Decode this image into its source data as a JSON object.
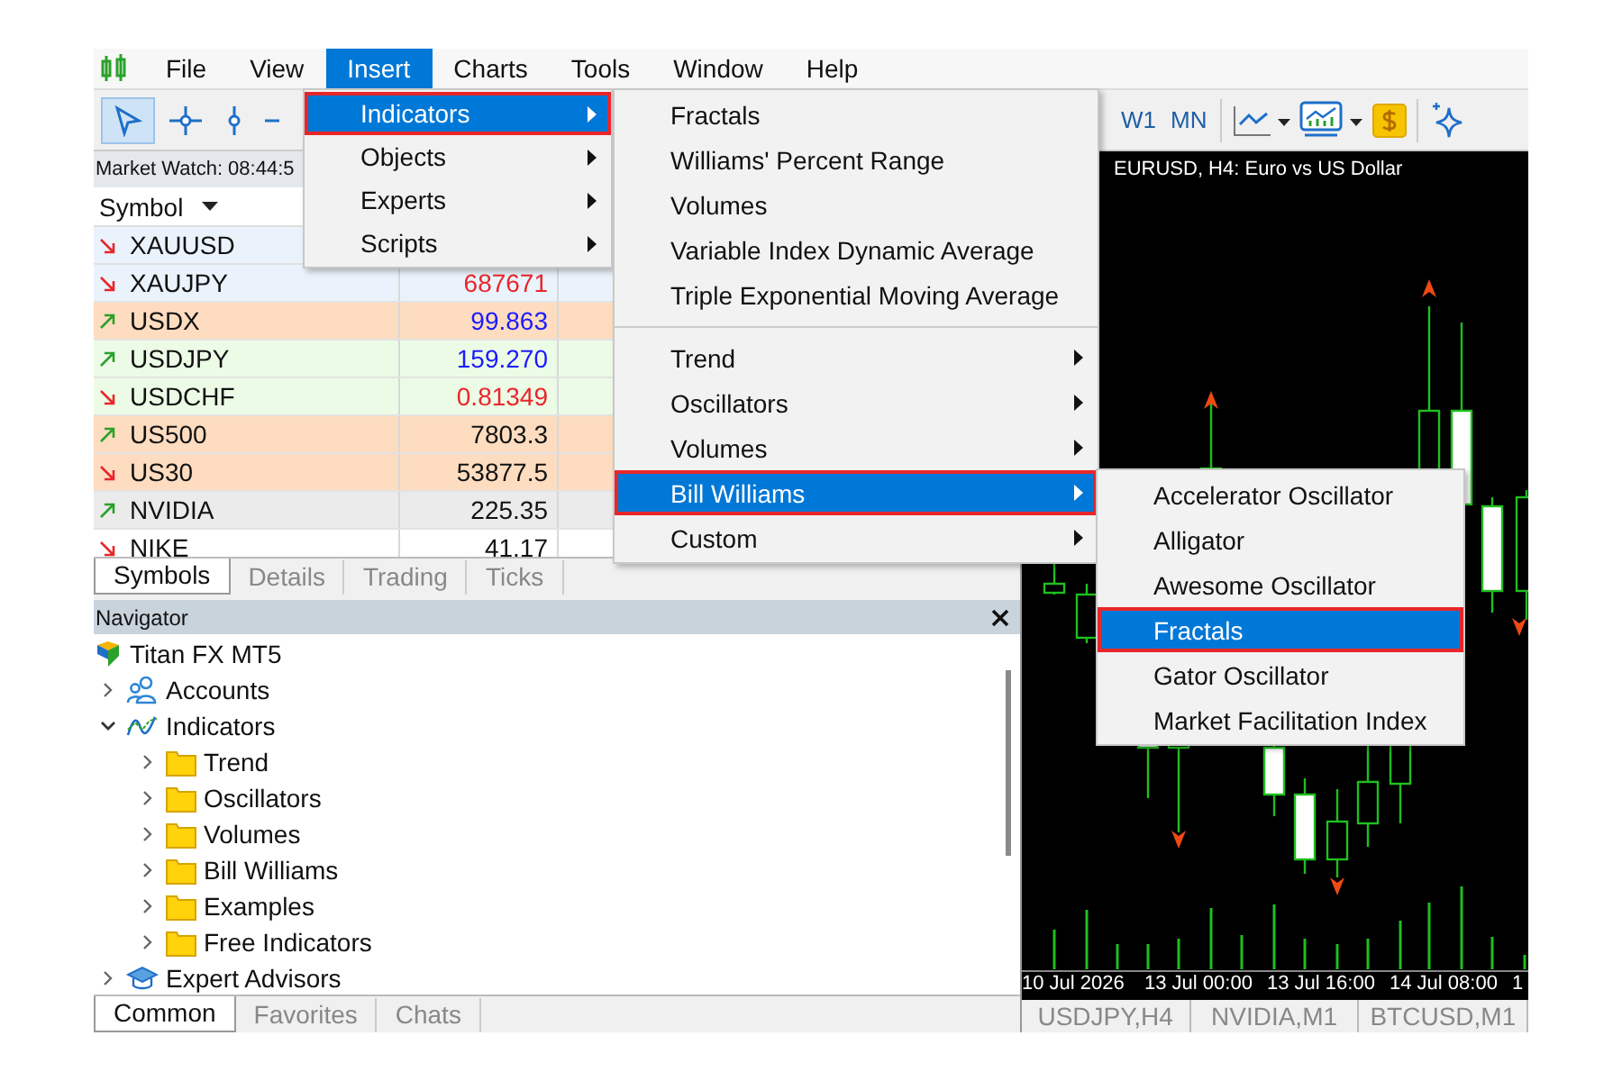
{
  "menubar": {
    "items": [
      {
        "label": "File",
        "selected": false
      },
      {
        "label": "View",
        "selected": false
      },
      {
        "label": "Insert",
        "selected": true
      },
      {
        "label": "Charts",
        "selected": false
      },
      {
        "label": "Tools",
        "selected": false
      },
      {
        "label": "Window",
        "selected": false
      },
      {
        "label": "Help",
        "selected": false
      }
    ]
  },
  "toolbar": {
    "tools": [
      {
        "kind": "cursor",
        "selected": true
      },
      {
        "kind": "crosshair",
        "selected": false
      },
      {
        "kind": "vertical_line",
        "selected": false
      },
      {
        "kind": "horizontal_line",
        "selected": false
      }
    ],
    "timeframes": [
      {
        "label": "W1",
        "selected": false
      },
      {
        "label": "MN",
        "selected": false
      }
    ]
  },
  "market_watch": {
    "title": "Market Watch: 08:44:5",
    "column": "Symbol",
    "rows": [
      {
        "symbol": "XAUUSD",
        "rising": false,
        "color": "#eaf3fc"
      },
      {
        "symbol": "XAUJPY",
        "rising": false,
        "bid": "687671",
        "price_rising": false,
        "color": "#eaf3fc"
      },
      {
        "symbol": "USDX",
        "rising": true,
        "bid": "99.863",
        "price_rising": true,
        "color": "#fddcc0"
      },
      {
        "symbol": "USDJPY",
        "rising": true,
        "bid": "159.270",
        "price_rising": true,
        "color": "#ecfbe6"
      },
      {
        "symbol": "USDCHF",
        "rising": false,
        "bid": "0.81349",
        "price_rising": false,
        "color": "#ecfbe6"
      },
      {
        "symbol": "US500",
        "rising": true,
        "bid": "7803.3",
        "color": "#fddcc0"
      },
      {
        "symbol": "US30",
        "rising": false,
        "bid": "53877.5",
        "color": "#fddcc0"
      },
      {
        "symbol": "NVIDIA",
        "rising": true,
        "bid": "225.35",
        "color": "#ebebeb"
      },
      {
        "symbol": "NIKE",
        "rising": false,
        "bid": "41.17",
        "color": "#ffffff"
      }
    ],
    "tabs": [
      {
        "label": "Symbols",
        "selected": true
      },
      {
        "label": "Details",
        "selected": false
      },
      {
        "label": "Trading",
        "selected": false
      },
      {
        "label": "Ticks",
        "selected": false
      }
    ]
  },
  "navigator": {
    "title": "Navigator",
    "tree": [
      {
        "label": "Titan FX MT5",
        "kind": "terminal",
        "children": [
          {
            "label": "Accounts",
            "kind": "accounts",
            "expanded": false
          },
          {
            "label": "Indicators",
            "kind": "indicators",
            "expanded": true,
            "children": [
              {
                "label": "Trend",
                "kind": "folder",
                "expanded": false
              },
              {
                "label": "Oscillators",
                "kind": "folder",
                "expanded": false
              },
              {
                "label": "Volumes",
                "kind": "folder",
                "expanded": false
              },
              {
                "label": "Bill Williams",
                "kind": "folder",
                "expanded": false
              },
              {
                "label": "Examples",
                "kind": "folder",
                "expanded": false
              },
              {
                "label": "Free Indicators",
                "kind": "folder",
                "expanded": false
              }
            ]
          },
          {
            "label": "Expert Advisors",
            "kind": "experts",
            "expanded": false
          }
        ]
      }
    ],
    "tabs": [
      {
        "label": "Common",
        "selected": true
      },
      {
        "label": "Favorites",
        "selected": false
      },
      {
        "label": "Chats",
        "selected": false
      }
    ]
  },
  "chart": {
    "title": "EURUSD, H4: Euro vs US Dollar",
    "time_labels": [
      "10 Jul 2026",
      "13 Jul 00:00",
      "13 Jul 16:00",
      "14 Jul 08:00",
      "1"
    ],
    "tabs": [
      {
        "label": "USDJPY,H4",
        "selected": false
      },
      {
        "label": "NVIDIA,M1",
        "selected": false
      },
      {
        "label": "BTCUSD,M1",
        "selected": false
      }
    ]
  },
  "insert_menu": {
    "items": [
      {
        "label": "Indicators",
        "selected": true,
        "has_submenu": true
      },
      {
        "label": "Objects",
        "selected": false,
        "has_submenu": true
      },
      {
        "label": "Experts",
        "selected": false,
        "has_submenu": true
      },
      {
        "label": "Scripts",
        "selected": false,
        "has_submenu": true
      }
    ]
  },
  "indicators_submenu": {
    "sections": [
      {
        "items": [
          {
            "label": "Fractals",
            "selected": false
          },
          {
            "label": "Williams' Percent Range",
            "selected": false
          },
          {
            "label": "Volumes",
            "selected": false
          },
          {
            "label": "Variable Index Dynamic Average",
            "selected": false
          },
          {
            "label": "Triple Exponential Moving Average",
            "selected": false
          }
        ]
      },
      {
        "items": [
          {
            "label": "Trend",
            "selected": false,
            "has_submenu": true
          },
          {
            "label": "Oscillators",
            "selected": false,
            "has_submenu": true
          },
          {
            "label": "Volumes",
            "selected": false,
            "has_submenu": true
          },
          {
            "label": "Bill Williams",
            "selected": true,
            "has_submenu": true
          },
          {
            "label": "Custom",
            "selected": false,
            "has_submenu": true
          }
        ]
      }
    ]
  },
  "bill_williams_submenu": {
    "items": [
      {
        "label": "Accelerator Oscillator",
        "selected": false
      },
      {
        "label": "Alligator",
        "selected": false
      },
      {
        "label": "Awesome Oscillator",
        "selected": false
      },
      {
        "label": "Fractals",
        "selected": true
      },
      {
        "label": "Gator Oscillator",
        "selected": false
      },
      {
        "label": "Market Facilitation Index",
        "selected": false
      }
    ]
  }
}
